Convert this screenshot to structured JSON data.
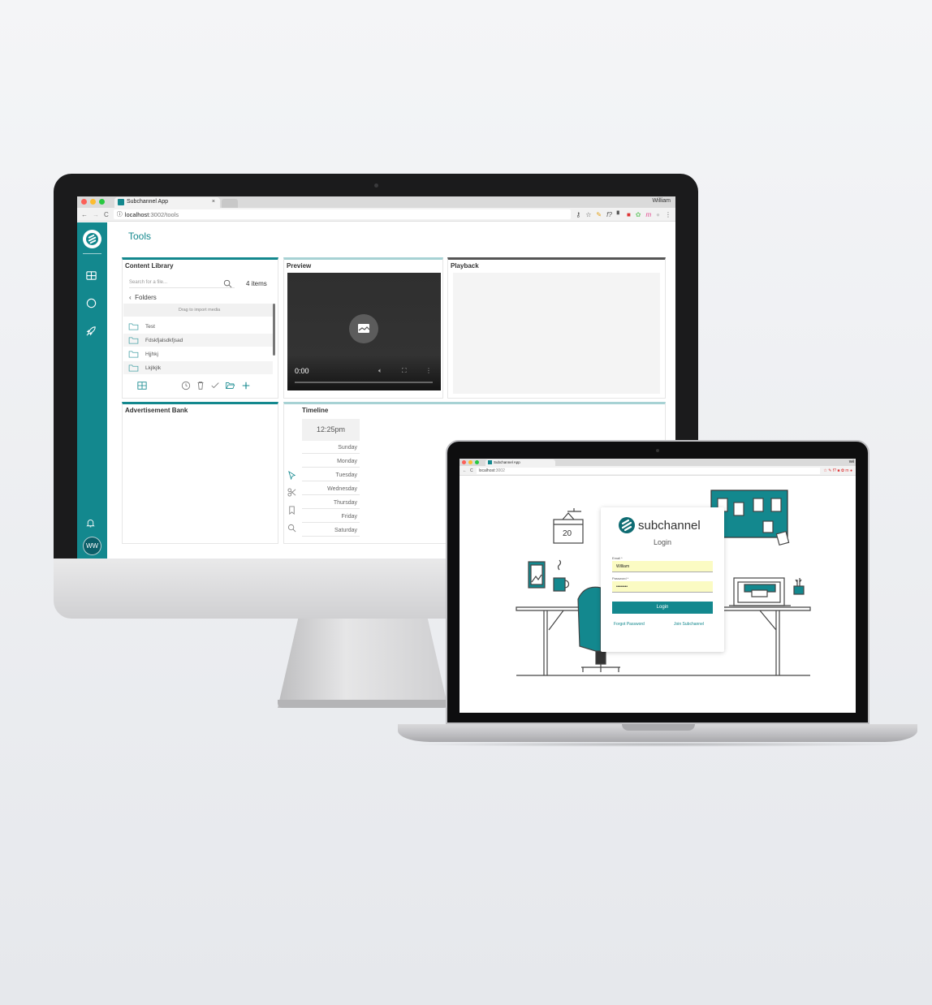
{
  "desktop": {
    "browser": {
      "tab_title": "Subchannel App",
      "tab_close": "×",
      "user_name": "William",
      "url_host": "localhost",
      "url_path": ":3002/tools"
    },
    "sidebar": {
      "items": [
        "grid-icon",
        "circle-icon",
        "rocket-icon"
      ],
      "bell": "bell-icon",
      "avatar_initials": "WW"
    },
    "page_title": "Tools",
    "content_library": {
      "title": "Content Library",
      "search_placeholder": "Search for a file...",
      "item_count": "4 items",
      "folders_label": "Folders",
      "drag_hint": "Drag to import media",
      "folders": [
        "Test",
        "Fdskfjalsdkfjsad",
        "Hjjhkj",
        "Lkjlkjlk"
      ]
    },
    "preview": {
      "title": "Preview",
      "time": "0:00"
    },
    "playback": {
      "title": "Playback"
    },
    "ad_bank": {
      "title": "Advertisement Bank"
    },
    "timeline": {
      "title": "Timeline",
      "time": "12:25pm",
      "days": [
        "Sunday",
        "Monday",
        "Tuesday",
        "Wednesday",
        "Thursday",
        "Friday",
        "Saturday"
      ]
    }
  },
  "laptop": {
    "browser": {
      "tab_title": "Subchannel App",
      "url_host": "localhost",
      "url_path": ":3002",
      "user_name": "Wil"
    },
    "calendar_day": "20",
    "login": {
      "brand": "subchannel",
      "title": "Login",
      "email_label": "Email *",
      "email_value": "William",
      "password_label": "Password *",
      "password_value": "••••••••",
      "button": "Login",
      "forgot": "Forgot Password",
      "join": "Join Subchannel"
    }
  },
  "colors": {
    "accent": "#13888e",
    "dark_accent": "#0b5f69"
  }
}
